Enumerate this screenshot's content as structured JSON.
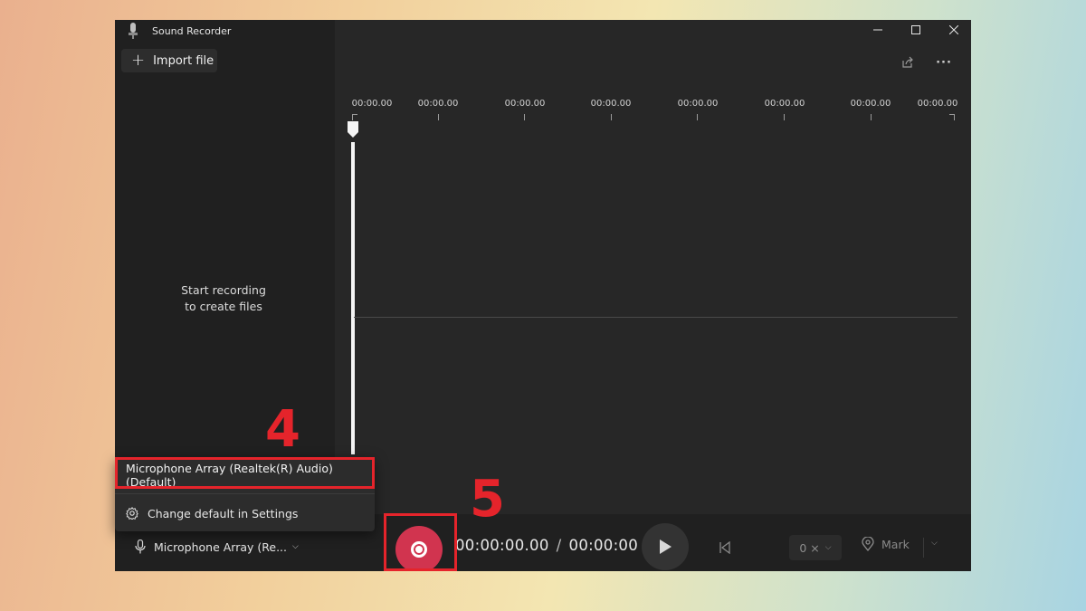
{
  "window": {
    "title": "Sound Recorder",
    "caption_buttons": {
      "minimize": "—",
      "maximize": "☐",
      "close": "✕"
    }
  },
  "sidebar": {
    "import_label": "Import file",
    "empty_line1": "Start recording",
    "empty_line2": "to create files"
  },
  "toolbar": {
    "share_icon": "share-icon",
    "more_label": "···"
  },
  "timeline": {
    "ruler_labels": [
      "00:00.00",
      "00:00.00",
      "00:00.00",
      "00:00.00",
      "00:00.00",
      "00:00.00",
      "00:00.00",
      "00:00.00"
    ]
  },
  "bottom_bar": {
    "mic_label": "Microphone Array (Re...",
    "current_time": "00:00:00.00",
    "separator": "/",
    "total_time": "00:00:00",
    "speed_label": "0 ×",
    "mark_label": "Mark"
  },
  "mic_menu": {
    "selected_device": "Microphone Array (Realtek(R) Audio) (Default)",
    "settings_label": "Change default in Settings"
  },
  "annotations": {
    "step_4": "4",
    "step_5": "5"
  },
  "colors": {
    "accent_record": "#d1344f",
    "annotation_red": "#e5242b",
    "window_bg": "#272727",
    "sidebar_bg": "#202020"
  }
}
